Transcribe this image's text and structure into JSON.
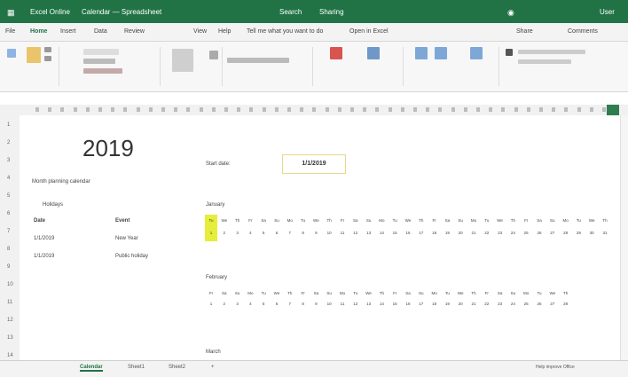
{
  "title_bar": {
    "app": "Excel Online",
    "file": "Calendar — Spreadsheet",
    "center_label": "Search",
    "status": "Sharing",
    "user": "User"
  },
  "menu_tabs": [
    "File",
    "Home",
    "Insert",
    "Data",
    "Review",
    "View",
    "Help",
    "Tell me what you want to do",
    "Open in Excel",
    "Share",
    "Comments"
  ],
  "sheet": {
    "year": "2019",
    "subtitle": "Month planning calendar",
    "row_label": "Holidays",
    "headers": {
      "date": "Date",
      "event": "Event"
    },
    "rows": [
      {
        "date": "1/1/2019",
        "event": "New Year"
      },
      {
        "date": "1/1/2019",
        "event": "Public holiday"
      }
    ],
    "date_label": "Start date:",
    "date_value": "1/1/2019"
  },
  "calendar": {
    "month1_label": "January",
    "month2_label": "February",
    "month3_label": "March",
    "month1_days": [
      "Tu",
      "We",
      "Th",
      "Fr",
      "Sa",
      "Su",
      "Mo",
      "Tu",
      "We",
      "Th",
      "Fr",
      "Sa",
      "Su",
      "Mo",
      "Tu",
      "We",
      "Th",
      "Fr",
      "Sa",
      "Su",
      "Mo",
      "Tu",
      "We",
      "Th",
      "Fr",
      "Sa",
      "Su",
      "Mo",
      "Tu",
      "We",
      "Th"
    ],
    "month1_dates": [
      "1",
      "2",
      "3",
      "4",
      "5",
      "6",
      "7",
      "8",
      "9",
      "10",
      "11",
      "12",
      "13",
      "14",
      "15",
      "16",
      "17",
      "18",
      "19",
      "20",
      "21",
      "22",
      "23",
      "24",
      "25",
      "26",
      "27",
      "28",
      "29",
      "30",
      "31"
    ],
    "month2_days": [
      "Fr",
      "Sa",
      "Su",
      "Mo",
      "Tu",
      "We",
      "Th",
      "Fr",
      "Sa",
      "Su",
      "Mo",
      "Tu",
      "We",
      "Th",
      "Fr",
      "Sa",
      "Su",
      "Mo",
      "Tu",
      "We",
      "Th",
      "Fr",
      "Sa",
      "Su",
      "Mo",
      "Tu",
      "We",
      "Th"
    ],
    "month2_dates": [
      "1",
      "2",
      "3",
      "4",
      "5",
      "6",
      "7",
      "8",
      "9",
      "10",
      "11",
      "12",
      "13",
      "14",
      "15",
      "16",
      "17",
      "18",
      "19",
      "20",
      "21",
      "22",
      "23",
      "24",
      "25",
      "26",
      "27",
      "28"
    ]
  },
  "sheet_tabs": [
    "Calendar",
    "Sheet1",
    "Sheet2",
    "+"
  ],
  "status_right": "Help improve Office"
}
